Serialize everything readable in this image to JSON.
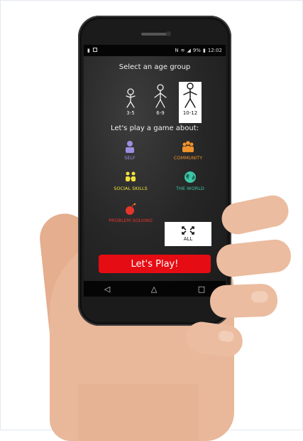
{
  "status_bar": {
    "nfc": "N",
    "battery": "9%",
    "time": "12:02"
  },
  "age_section": {
    "title": "Select an age group",
    "groups": [
      {
        "label": "3-5",
        "selected": false
      },
      {
        "label": "6-9",
        "selected": false
      },
      {
        "label": "10-12",
        "selected": true
      }
    ]
  },
  "topic_section": {
    "title": "Let's play a game about:",
    "topics": [
      {
        "label": "SELF",
        "color": "#9b8fe0",
        "icon": "person-icon"
      },
      {
        "label": "COMMUNITY",
        "color": "#f0932b",
        "icon": "group-icon"
      },
      {
        "label": "SOCIAL SKILLS",
        "color": "#f2e23a",
        "icon": "people-pair-icon"
      },
      {
        "label": "THE WORLD",
        "color": "#3cc7a6",
        "icon": "globe-icon"
      },
      {
        "label": "PROBLEM SOLVING",
        "color": "#e5352b",
        "icon": "bomb-icon"
      },
      {
        "label": "ALL",
        "color": "#111111",
        "icon": "expand-icon",
        "selected": true
      }
    ]
  },
  "play_button": {
    "label": "Let's Play!",
    "color": "#e60c13"
  },
  "nav_bar": {
    "back": "◁",
    "home": "△",
    "recents": "□"
  }
}
